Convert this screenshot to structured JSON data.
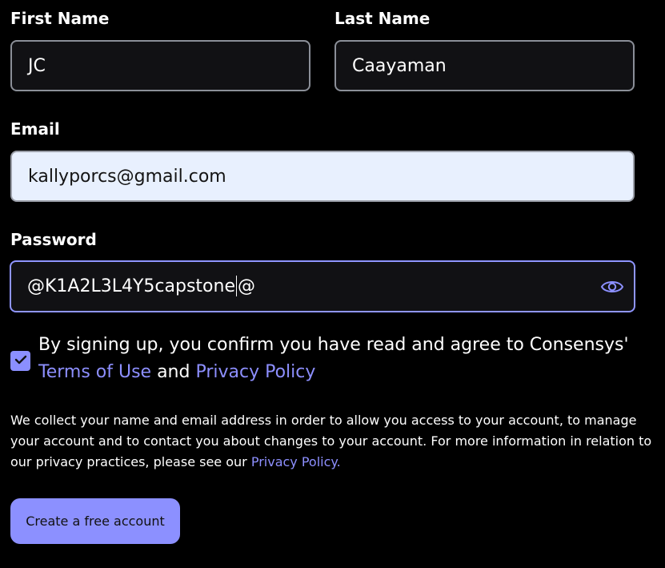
{
  "form": {
    "first_name": {
      "label": "First Name",
      "value": "JC"
    },
    "last_name": {
      "label": "Last Name",
      "value": "Caayaman"
    },
    "email": {
      "label": "Email",
      "value": "kallyporcs@gmail.com"
    },
    "password": {
      "label": "Password",
      "value_before_caret": "@K1A2L3L4Y5capstone",
      "value_after_caret": "@",
      "toggle_icon": "eye-icon"
    },
    "consent": {
      "checked": true,
      "text_prefix": "By signing up, you confirm you have read and agree to Consensys' ",
      "terms_link": "Terms of Use",
      "and_text": " and ",
      "privacy_link": "Privacy Policy"
    },
    "notice": {
      "text": "We collect your name and email address in order to allow you access to your account, to manage your account and to contact you about changes to your account. For more information in relation to our privacy practices, please see our ",
      "privacy_link": "Privacy Policy."
    },
    "submit_label": "Create a free account"
  },
  "colors": {
    "background": "#000000",
    "accent": "#8c90ff",
    "field_bg": "#111114",
    "email_autofill_bg": "#e8f0fe"
  }
}
